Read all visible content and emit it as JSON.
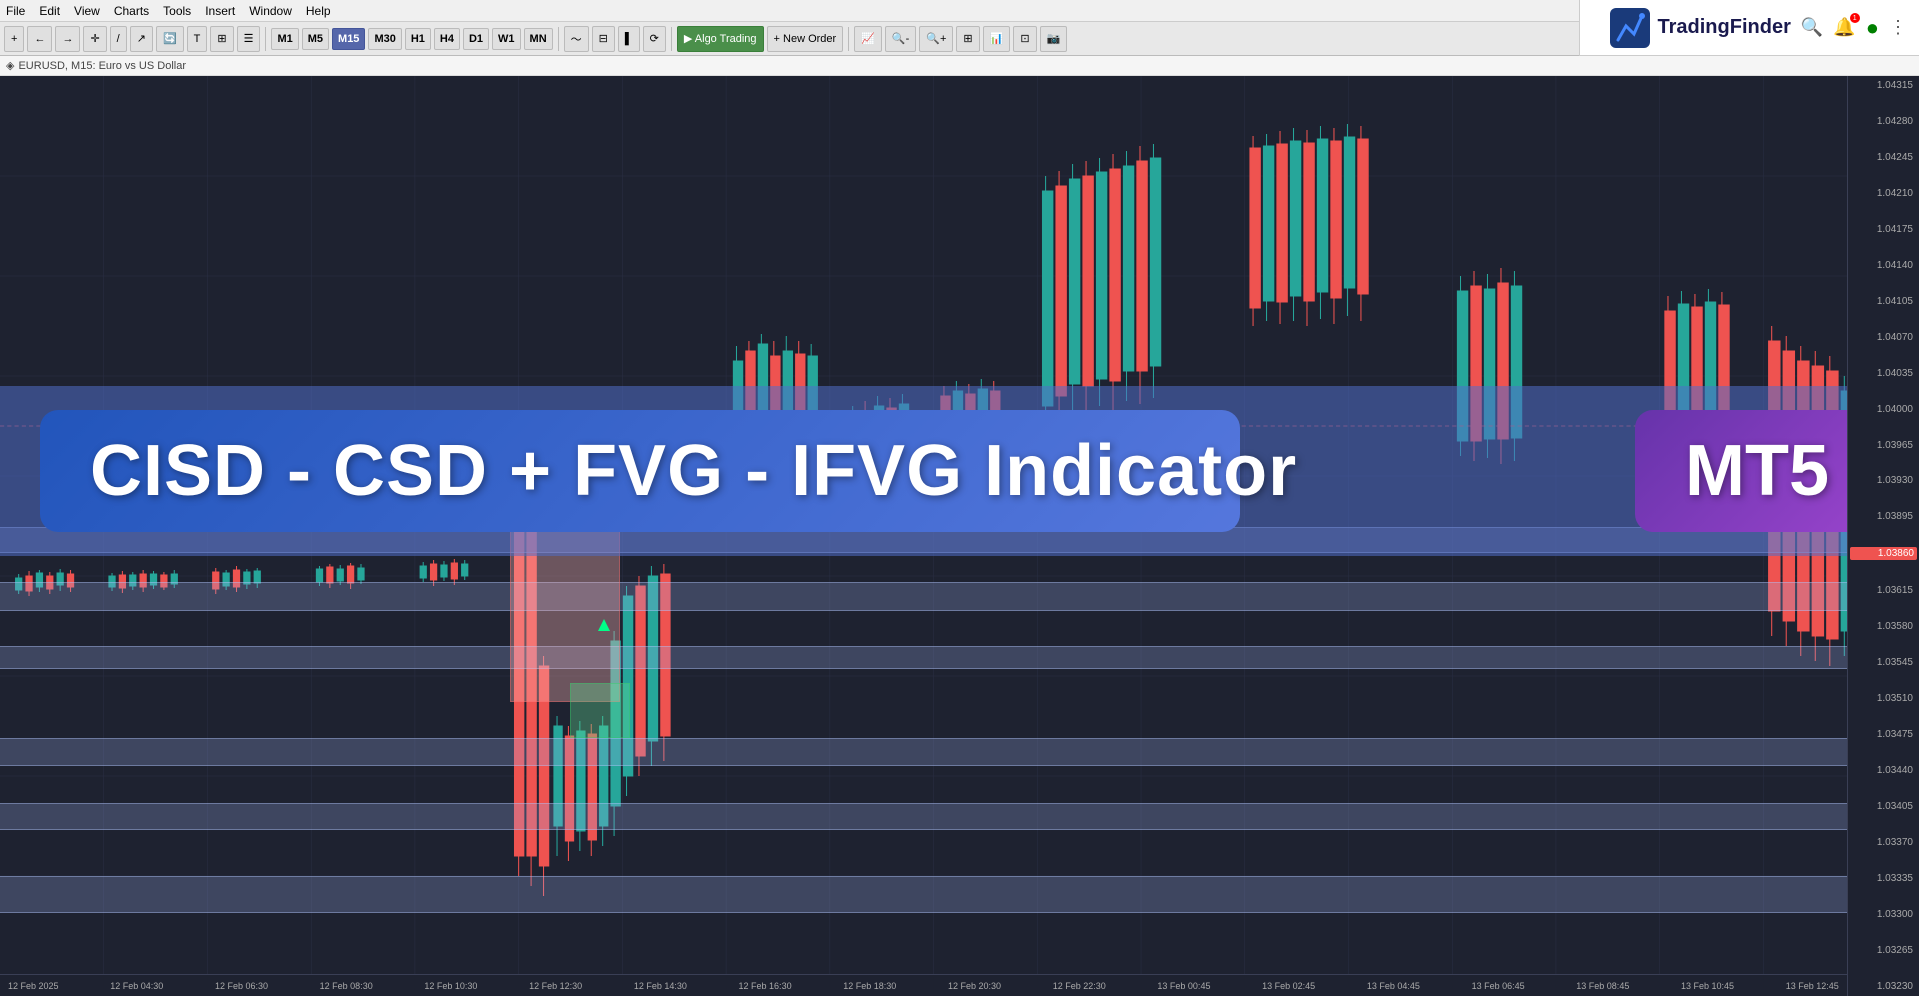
{
  "menu": {
    "items": [
      "File",
      "Edit",
      "View",
      "Charts",
      "Tools",
      "Insert",
      "Window",
      "Help"
    ]
  },
  "toolbar": {
    "nav_buttons": [
      "←",
      "→",
      "+",
      "−",
      "↑"
    ],
    "drawing_tools": [
      "✏",
      "↗",
      "🔄",
      "T",
      "⊞"
    ],
    "timeframes": [
      "M1",
      "M5",
      "M15",
      "M30",
      "H1",
      "H4",
      "D1",
      "W1",
      "MN"
    ],
    "active_timeframe": "M15",
    "chart_tools": [
      "~",
      "□",
      "●",
      "⟳"
    ],
    "algo_trading": "Algo Trading",
    "new_order": "New Order",
    "strategy_icons": [
      "📈",
      "📊",
      "🔍",
      "⊟",
      "⊞",
      "⚙"
    ]
  },
  "chart_info": {
    "symbol": "EURUSD",
    "timeframe": "M15",
    "description": "Euro vs US Dollar"
  },
  "brand": {
    "name": "TradingFinder",
    "logo_color": "#1a3a7a"
  },
  "overlay": {
    "main_title": "CISD - CSD + FVG - IFVG Indicator",
    "platform": "MT5"
  },
  "price_levels": [
    "1.04315",
    "1.04280",
    "1.04245",
    "1.04210",
    "1.04175",
    "1.04140",
    "1.04105",
    "1.04070",
    "1.04035",
    "1.04000",
    "1.03965",
    "1.03930",
    "1.03895",
    "1.03860",
    "1.03615",
    "1.03580",
    "1.03545",
    "1.03510",
    "1.03475",
    "1.03440",
    "1.03405",
    "1.03370",
    "1.03335",
    "1.03300",
    "1.03265",
    "1.03230"
  ],
  "time_labels": [
    "12 Feb 2025",
    "12 Feb 04:30",
    "12 Feb 06:30",
    "12 Feb 08:30",
    "12 Feb 10:30",
    "12 Feb 12:30",
    "12 Feb 14:30",
    "12 Feb 16:30",
    "12 Feb 18:30",
    "12 Feb 20:30",
    "12 Feb 22:30",
    "13 Feb 00:45",
    "13 Feb 02:45",
    "13 Feb 04:45",
    "13 Feb 06:45",
    "13 Feb 08:45",
    "13 Feb 10:45",
    "13 Feb 12:45"
  ],
  "fvg_bands": [
    {
      "top_pct": 50,
      "height_pct": 3,
      "label": "upper-fvg-1"
    },
    {
      "top_pct": 56,
      "height_pct": 3.5,
      "label": "upper-fvg-2"
    },
    {
      "top_pct": 62,
      "height_pct": 2.5,
      "label": "mid-fvg"
    },
    {
      "top_pct": 73,
      "height_pct": 3,
      "label": "lower-fvg-1"
    },
    {
      "top_pct": 80,
      "height_pct": 3,
      "label": "lower-fvg-2"
    },
    {
      "top_pct": 88,
      "height_pct": 4,
      "label": "bottom-fvg"
    }
  ]
}
